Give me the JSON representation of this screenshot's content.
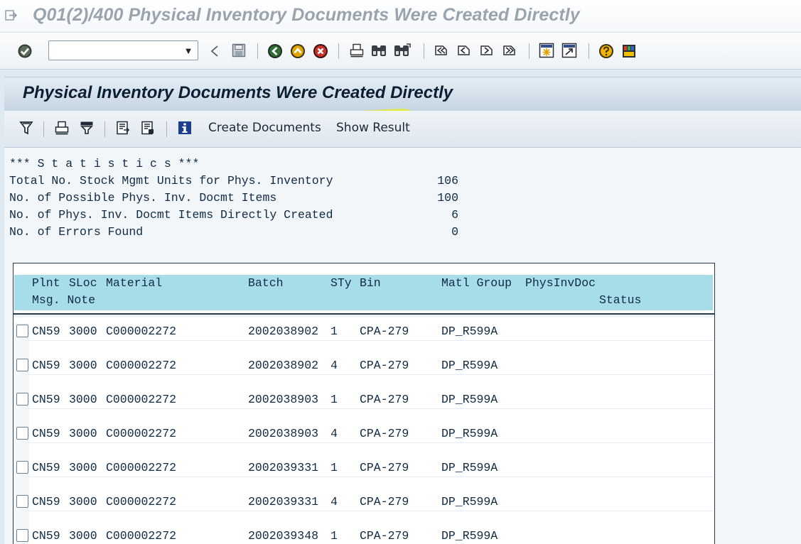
{
  "window": {
    "title": "Q01(2)/400 Physical Inventory Documents Were Created Directly"
  },
  "toolbar": {
    "command_field_value": "",
    "command_field_placeholder": "",
    "icons": [
      "enter-checkmark",
      "back-arrow",
      "save-disk",
      "back-green",
      "exit-yellow",
      "cancel-red",
      "print",
      "find",
      "find-next",
      "first-page",
      "previous-page",
      "next-page",
      "last-page",
      "create-session",
      "generate-shortcut",
      "help",
      "customize-layout"
    ]
  },
  "screen": {
    "title": "Physical Inventory Documents Were Created Directly"
  },
  "app_toolbar": {
    "icons": [
      "filter",
      "print",
      "set-filter",
      "export",
      "export-local",
      "information"
    ],
    "create_documents": "Create Documents",
    "show_result": "Show Result",
    "highlight_color": "#e6ef28"
  },
  "statistics": {
    "header": "*** S t a t i s t i c s ***",
    "items": [
      {
        "label": "Total No. Stock Mgmt Units for Phys. Inventory",
        "value": "106"
      },
      {
        "label": "No. of Possible Phys. Inv. Docmt Items",
        "value": "100"
      },
      {
        "label": "No. of Phys. Inv. Docmt Items Directly Created",
        "value": "6"
      },
      {
        "label": "No. of Errors Found",
        "value": "0"
      }
    ]
  },
  "table": {
    "headers": {
      "plnt": "Plnt",
      "sloc": "SLoc",
      "material": "Material",
      "batch": "Batch",
      "sty": "STy",
      "bin": "Bin",
      "matl_group": "Matl Group",
      "physinvdoc": "PhysInvDoc",
      "msg_note": "Msg. Note",
      "status": "Status"
    },
    "header_color": "#a6dde9",
    "rows": [
      {
        "plnt": "CN59",
        "sloc": "3000",
        "material": "C000002272",
        "batch": "2002038902",
        "sty": "1",
        "bin": "CPA-279",
        "matl_group": "DP_R599A"
      },
      {
        "plnt": "CN59",
        "sloc": "3000",
        "material": "C000002272",
        "batch": "2002038902",
        "sty": "4",
        "bin": "CPA-279",
        "matl_group": "DP_R599A"
      },
      {
        "plnt": "CN59",
        "sloc": "3000",
        "material": "C000002272",
        "batch": "2002038903",
        "sty": "1",
        "bin": "CPA-279",
        "matl_group": "DP_R599A"
      },
      {
        "plnt": "CN59",
        "sloc": "3000",
        "material": "C000002272",
        "batch": "2002038903",
        "sty": "4",
        "bin": "CPA-279",
        "matl_group": "DP_R599A"
      },
      {
        "plnt": "CN59",
        "sloc": "3000",
        "material": "C000002272",
        "batch": "2002039331",
        "sty": "1",
        "bin": "CPA-279",
        "matl_group": "DP_R599A"
      },
      {
        "plnt": "CN59",
        "sloc": "3000",
        "material": "C000002272",
        "batch": "2002039331",
        "sty": "4",
        "bin": "CPA-279",
        "matl_group": "DP_R599A"
      },
      {
        "plnt": "CN59",
        "sloc": "3000",
        "material": "C000002272",
        "batch": "2002039348",
        "sty": "1",
        "bin": "CPA-279",
        "matl_group": "DP_R599A"
      }
    ]
  }
}
